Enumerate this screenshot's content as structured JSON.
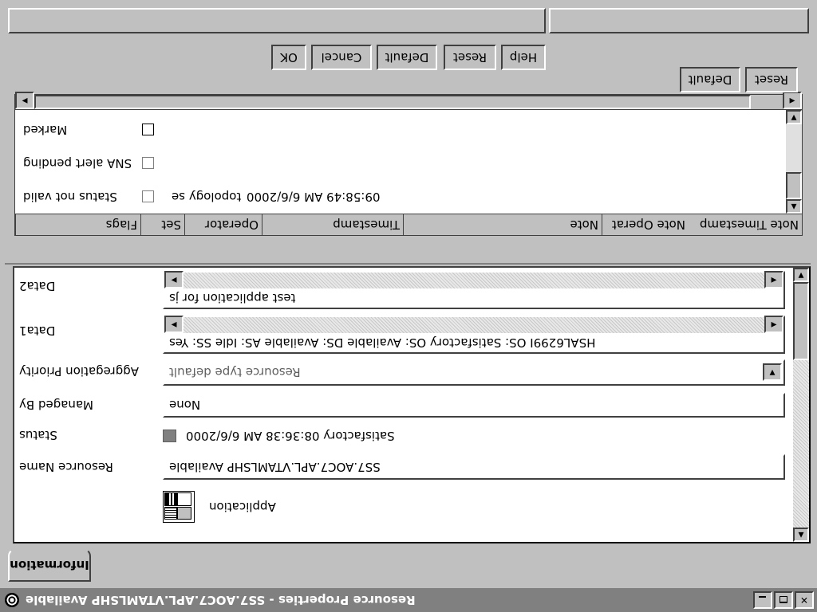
{
  "window": {
    "title": "Resource Properties - SS7.AOC7.APL.VTAMLSHP Available",
    "icon": "resource-globe-icon"
  },
  "tabs": [
    {
      "label": "Information",
      "selected": true
    }
  ],
  "resource": {
    "type_label": "Application",
    "type_icon": "application-icon"
  },
  "fields": {
    "resource_name": {
      "label": "Resource Name",
      "value": "SS7.AOC7.APL.VTAMLSHP Available"
    },
    "status": {
      "label": "Status",
      "value": "Satisfactory  08:36:38 AM  6/6/2000",
      "color": "#808080"
    },
    "managed_by": {
      "label": "Managed By",
      "value": "None"
    },
    "aggregation_priority": {
      "label": "Aggregation Priority",
      "value": "Resource type default"
    },
    "data1": {
      "label": "Data1",
      "value": "HSAL6299I OS: Satisfactory OS: Available DS: Available AS: Idle SS: Yes"
    },
    "data2": {
      "label": "Data2",
      "value": "test application for js"
    }
  },
  "flags_table": {
    "columns": [
      "Flags",
      "Set",
      "Operator",
      "Timestamp",
      "Note",
      "Note Operat",
      "Note Timestamp"
    ],
    "rows": [
      {
        "flag": "Status not valid",
        "set": false,
        "enabled": false,
        "operator": "topology se",
        "timestamp": "09:58:49 AM  6/6/2000"
      },
      {
        "flag": "SNA alert pending",
        "set": false,
        "enabled": false,
        "operator": "",
        "timestamp": ""
      },
      {
        "flag": "Marked",
        "set": false,
        "enabled": true,
        "operator": "",
        "timestamp": ""
      }
    ],
    "buttons": {
      "reset": "Reset",
      "default": "Default"
    }
  },
  "dialog_buttons": {
    "help": "Help",
    "reset": "Reset",
    "default": "Default",
    "cancel": "Cancel",
    "ok": "OK"
  },
  "status_bar": {
    "left": "",
    "right": ""
  }
}
